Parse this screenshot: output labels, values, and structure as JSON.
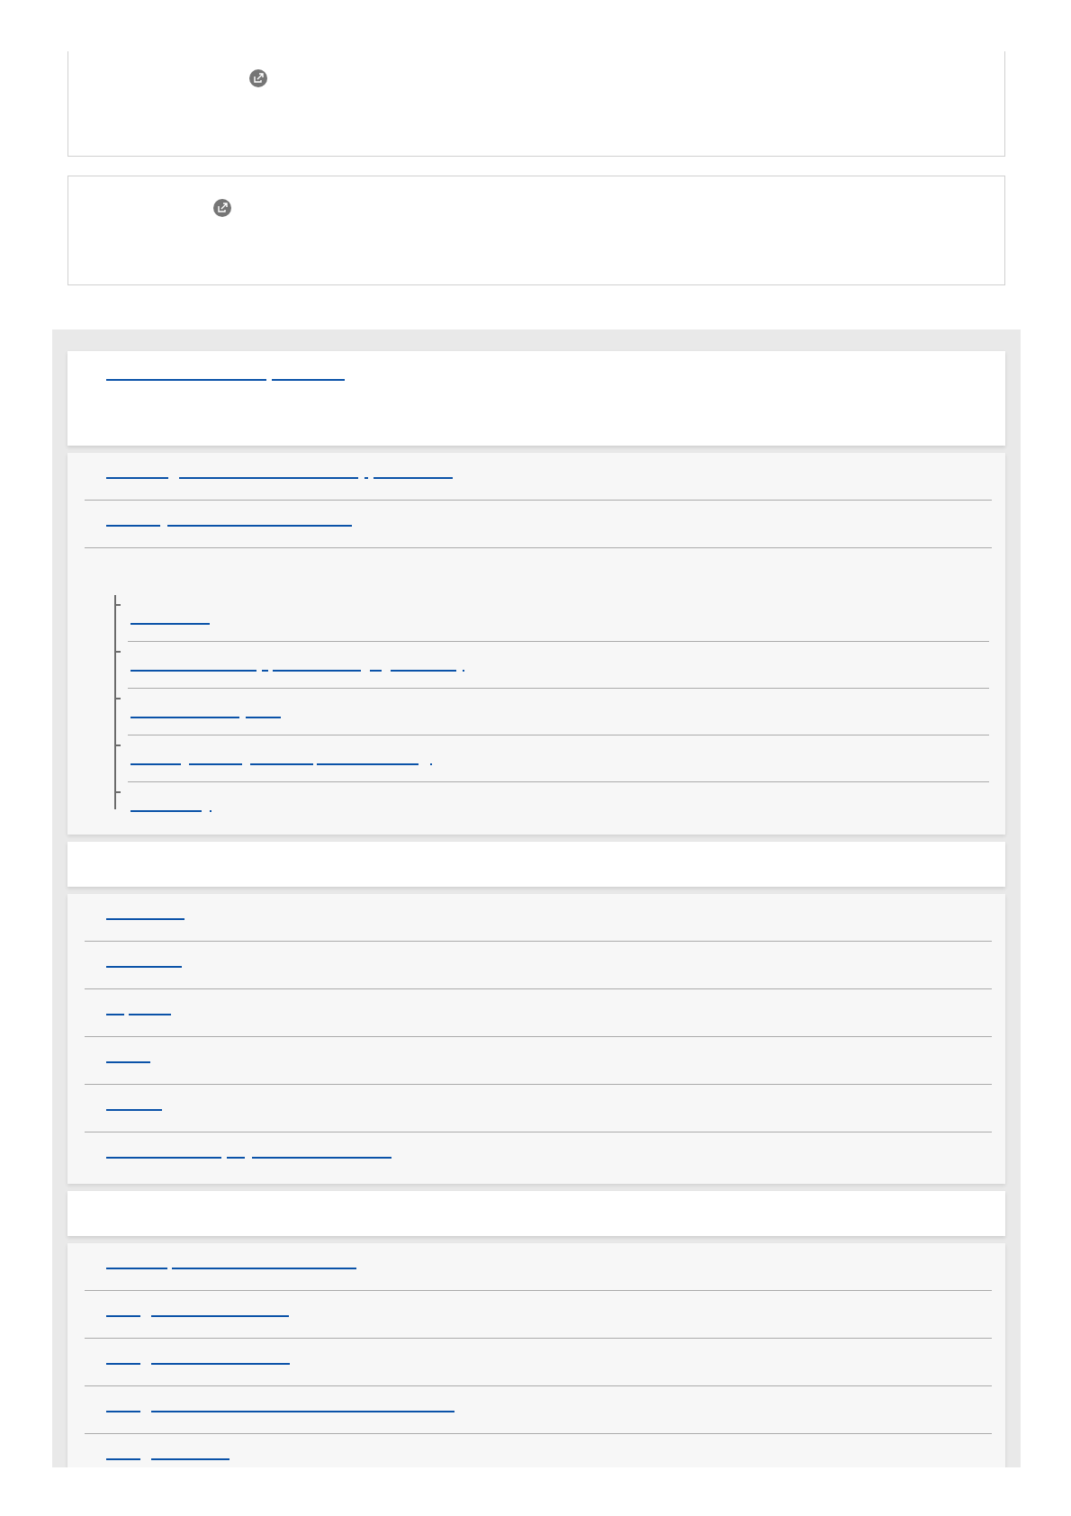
{
  "external_cards": [
    {
      "kind": "external-link"
    },
    {
      "kind": "external-link"
    }
  ],
  "sections": [
    {
      "kind": "heading",
      "links": [
        {
          "kind": "link"
        }
      ]
    },
    {
      "kind": "list",
      "items": [
        {
          "kind": "link"
        },
        {
          "kind": "link"
        },
        {
          "kind": "tree",
          "children": [
            {
              "kind": "link"
            },
            {
              "kind": "link"
            },
            {
              "kind": "link"
            },
            {
              "kind": "link"
            },
            {
              "kind": "link"
            }
          ]
        }
      ]
    },
    {
      "kind": "heading"
    },
    {
      "kind": "list",
      "items": [
        {
          "kind": "link"
        },
        {
          "kind": "link"
        },
        {
          "kind": "link"
        },
        {
          "kind": "link"
        },
        {
          "kind": "link"
        },
        {
          "kind": "link"
        }
      ]
    },
    {
      "kind": "heading"
    },
    {
      "kind": "list",
      "items": [
        {
          "kind": "link"
        },
        {
          "kind": "link"
        },
        {
          "kind": "link"
        },
        {
          "kind": "link"
        },
        {
          "kind": "link"
        }
      ]
    }
  ]
}
